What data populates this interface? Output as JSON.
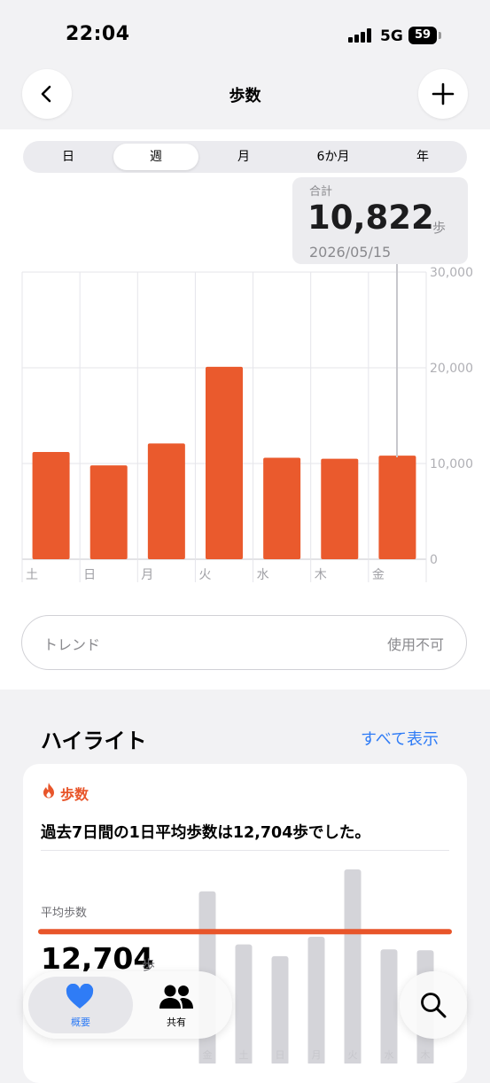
{
  "status_bar": {
    "time": "22:04",
    "network": "5G",
    "battery": "59"
  },
  "header": {
    "title": "歩数",
    "back_icon": "chevron-left-icon",
    "add_icon": "plus-icon"
  },
  "segments": [
    {
      "label": "日",
      "selected": false
    },
    {
      "label": "週",
      "selected": true
    },
    {
      "label": "月",
      "selected": false
    },
    {
      "label": "6か月",
      "selected": false
    },
    {
      "label": "年",
      "selected": false
    }
  ],
  "tooltip": {
    "label": "合計",
    "value": "10,822",
    "unit": "歩",
    "date": "2026/05/15"
  },
  "chart_data": {
    "type": "bar",
    "categories": [
      "土",
      "日",
      "月",
      "火",
      "水",
      "木",
      "金"
    ],
    "values": [
      11200,
      9800,
      12100,
      20100,
      10600,
      10500,
      10822
    ],
    "ylim": [
      0,
      30000
    ],
    "y_ticks": [
      "0",
      "10,000",
      "20,000",
      "30,000"
    ],
    "bar_color": "#ea5a2d",
    "grid": true
  },
  "trend": {
    "label": "トレンド",
    "value": "使用不可"
  },
  "highlights": {
    "title": "ハイライト",
    "show_all": "すべて表示",
    "card": {
      "category": "歩数",
      "category_icon": "flame-icon",
      "text": "過去7日間の1日平均歩数は12,704歩でした。",
      "avg_label": "平均歩数",
      "avg_value": "12,704",
      "avg_unit": "歩",
      "mini_chart": {
        "categories": [
          "金",
          "土",
          "日",
          "月",
          "火",
          "水",
          "木"
        ],
        "values": [
          17500,
          11200,
          9800,
          12100,
          20100,
          10600,
          10500
        ],
        "average": 12704
      }
    }
  },
  "tab_bar": {
    "tabs": [
      {
        "label": "概要",
        "icon": "heart-icon",
        "selected": true
      },
      {
        "label": "共有",
        "icon": "people-icon",
        "selected": false
      }
    ],
    "search_icon": "search-icon"
  }
}
